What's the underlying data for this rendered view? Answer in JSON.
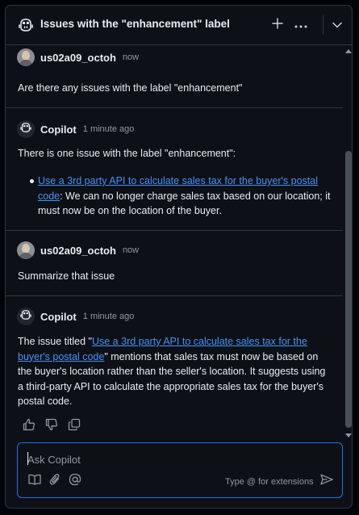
{
  "header": {
    "title": "Issues with the \"enhancement\" label",
    "icons": [
      "copilot-icon",
      "plus-icon",
      "kebab-icon",
      "chevron-down-icon"
    ]
  },
  "messages": [
    {
      "author": "us02a09_octoh",
      "time": "now",
      "text": "Are there any issues with the label \"enhancement\""
    },
    {
      "author": "Copilot",
      "time": "1 minute ago",
      "intro": "There is one issue with the label \"enhancement\":",
      "bullet_link_1": "Use a 3rd party API to calculate sales tax for the buyer's postal",
      "bullet_link_2": "code",
      "bullet_rest_1": ": We can no longer charge sales tax based on our location; it",
      "bullet_rest_2": "must now be on the location of the buyer."
    },
    {
      "author": "us02a09_octoh",
      "time": "now",
      "text": "Summarize that issue"
    },
    {
      "author": "Copilot",
      "time": "1 minute ago",
      "line1_pre": "The issue titled \"",
      "line1_link": "Use a 3rd party API to calculate sales tax for the",
      "line2_link": "buyer's postal code",
      "line2_rest": "\" mentions that sales tax must now be based on",
      "line3": "the buyer's location rather than the seller's location. It suggests using",
      "line4": "a third-party API to calculate the appropriate sales tax for the buyer's",
      "line5": "postal code."
    }
  ],
  "feedback_icons": [
    "thumbs-up-icon",
    "thumbs-down-icon",
    "copy-icon"
  ],
  "composer": {
    "placeholder": "Ask Copilot",
    "hint": "Type @ for extensions",
    "icons": [
      "book-icon",
      "paperclip-icon",
      "mention-icon",
      "send-icon"
    ]
  },
  "colors": {
    "background": "#0d1117",
    "border": "#30363d",
    "link": "#4493f8",
    "focus": "#1f6feb",
    "muted": "#9198a1"
  }
}
